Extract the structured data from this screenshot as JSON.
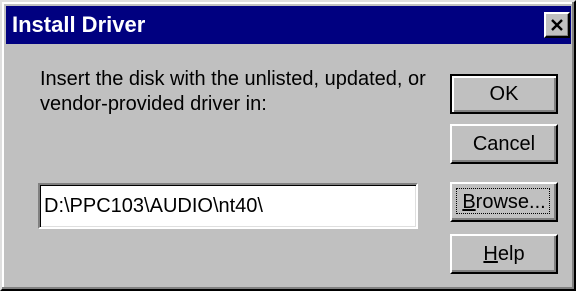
{
  "window": {
    "title": "Install Driver"
  },
  "message": {
    "text": "Insert the disk with the unlisted, updated, or vendor-provided driver in:"
  },
  "path_field": {
    "value": "D:\\PPC103\\AUDIO\\nt40\\"
  },
  "buttons": {
    "ok": "OK",
    "cancel": "Cancel",
    "browse_prefix": "",
    "browse_mnemonic": "B",
    "browse_rest": "rowse...",
    "help_mnemonic": "H",
    "help_rest": "elp"
  },
  "colors": {
    "titlebar": "#000080",
    "face": "#c0c0c0"
  },
  "icons": {
    "close": "close-icon"
  }
}
